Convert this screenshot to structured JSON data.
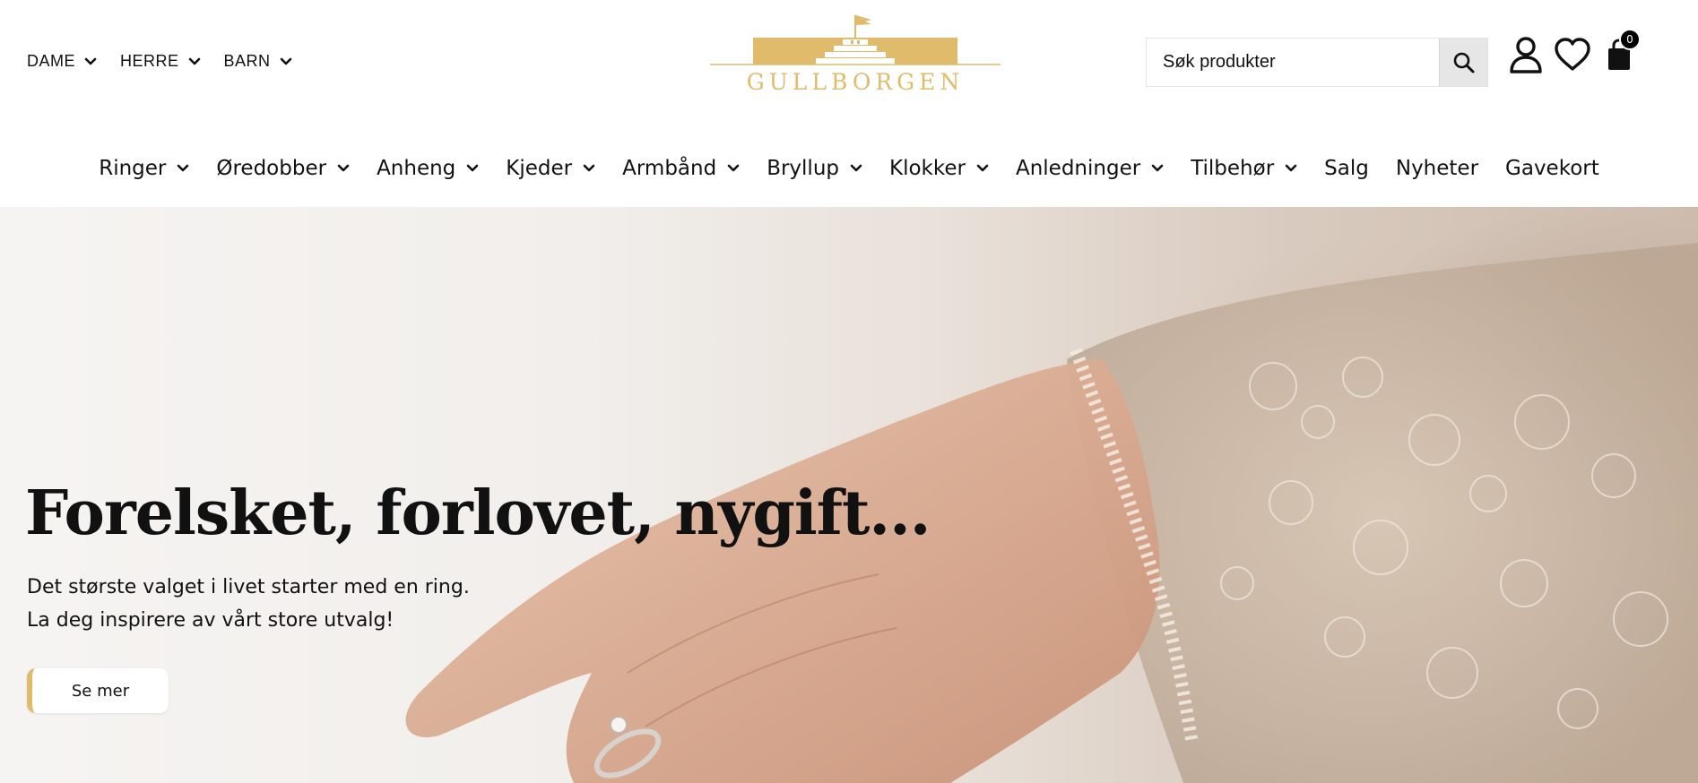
{
  "header": {
    "gender_nav": [
      {
        "label": "DAME"
      },
      {
        "label": "HERRE"
      },
      {
        "label": "BARN"
      }
    ],
    "logo_text": "GULLBORGEN",
    "search": {
      "placeholder": "Søk produkter"
    },
    "icons": [
      "user-icon",
      "heart-icon",
      "cart-icon"
    ],
    "cart_count": "0"
  },
  "main_nav": [
    {
      "label": "Ringer",
      "dropdown": true
    },
    {
      "label": "Øredobber",
      "dropdown": true
    },
    {
      "label": "Anheng",
      "dropdown": true
    },
    {
      "label": "Kjeder",
      "dropdown": true
    },
    {
      "label": "Armbånd",
      "dropdown": true
    },
    {
      "label": "Bryllup",
      "dropdown": true
    },
    {
      "label": "Klokker",
      "dropdown": true
    },
    {
      "label": "Anledninger",
      "dropdown": true
    },
    {
      "label": "Tilbehør",
      "dropdown": true
    },
    {
      "label": "Salg",
      "dropdown": false
    },
    {
      "label": "Nyheter",
      "dropdown": false
    },
    {
      "label": "Gavekort",
      "dropdown": false
    }
  ],
  "hero": {
    "title": "Forelsket, forlovet, nygift...",
    "line1": "Det største valget i livet starter med en ring.",
    "line2": "La deg inspirere av vårt store utvalg!",
    "button_label": "Se mer"
  },
  "colors": {
    "brand_gold": "#e0bb6c",
    "text": "#111111"
  }
}
